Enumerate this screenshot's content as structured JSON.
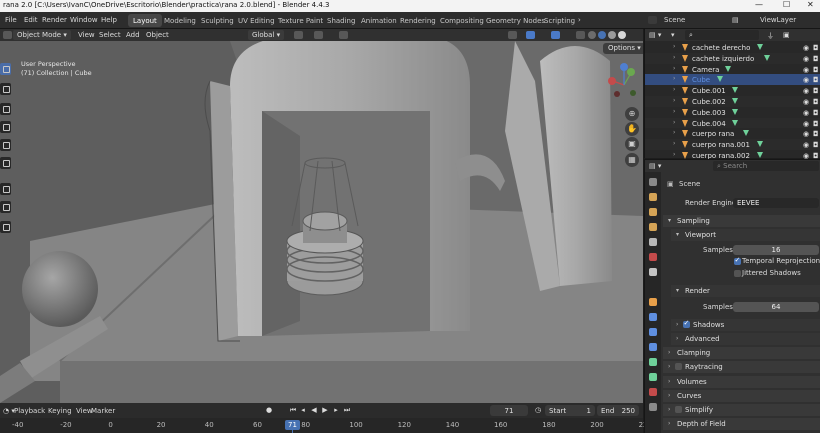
{
  "window": {
    "title": "rana 2.0 [C:\\Users\\IvanC\\OneDrive\\Escritorio\\Blender\\practica\\rana 2.0.blend] - Blender 4.4.3"
  },
  "menu": [
    "File",
    "Edit",
    "Render",
    "Window",
    "Help"
  ],
  "workspaces": {
    "active": "Layout",
    "tabs": [
      "Layout",
      "Modeling",
      "Sculpting",
      "UV Editing",
      "Texture Paint",
      "Shading",
      "Animation",
      "Rendering",
      "Compositing",
      "Geometry Nodes",
      "Scripting"
    ]
  },
  "scene": {
    "name": "Scene",
    "view_layer": "ViewLayer"
  },
  "viewport_header": {
    "mode": "Object Mode",
    "menus": [
      "View",
      "Select",
      "Add",
      "Object"
    ],
    "orientation": "Global"
  },
  "viewport": {
    "view_name": "User Perspective",
    "collection": "(71) Collection | Cube",
    "options_label": "Options",
    "gizmo_axes": {
      "x": "X",
      "y": "Y",
      "z": "Z"
    }
  },
  "timeline": {
    "menus": [
      "Playback",
      "Keying",
      "View",
      "Marker"
    ],
    "current_frame": "71",
    "start_label": "Start",
    "start": "1",
    "end_label": "End",
    "end": "250",
    "ruler": [
      "-40",
      "-20",
      "0",
      "20",
      "40",
      "60",
      "80",
      "100",
      "120",
      "140",
      "160",
      "180",
      "200",
      "220"
    ]
  },
  "outliner": {
    "items": [
      {
        "name": "cachete derecho",
        "selected": false
      },
      {
        "name": "cachete izquierdo",
        "selected": false
      },
      {
        "name": "Camera",
        "selected": false
      },
      {
        "name": "Cube",
        "selected": true
      },
      {
        "name": "Cube.001",
        "selected": false
      },
      {
        "name": "Cube.002",
        "selected": false
      },
      {
        "name": "Cube.003",
        "selected": false
      },
      {
        "name": "Cube.004",
        "selected": false
      },
      {
        "name": "cuerpo rana",
        "selected": false
      },
      {
        "name": "cuerpo rana.001",
        "selected": false
      },
      {
        "name": "cuerpo rana.002",
        "selected": false
      }
    ]
  },
  "properties": {
    "search_placeholder": "Search",
    "context": "Scene",
    "render_engine_label": "Render Engine",
    "render_engine": "EEVEE",
    "sampling": {
      "title": "Sampling",
      "viewport_title": "Viewport",
      "viewport_samples_label": "Samples",
      "viewport_samples": "16",
      "temporal_reprojection": "Temporal Reprojection",
      "temporal_reprojection_on": true,
      "jittered_shadows": "Jittered Shadows",
      "jittered_shadows_on": false,
      "render_title": "Render",
      "render_samples_label": "Samples",
      "render_samples": "64",
      "shadows": "Shadows",
      "shadows_on": true,
      "advanced": "Advanced"
    },
    "panels": [
      "Clamping",
      "Raytracing",
      "Volumes",
      "Curves",
      "Simplify",
      "Depth of Field"
    ]
  },
  "colors": {
    "accent": "#4772b3",
    "brand_orange": "#e87d0d",
    "object_orange": "#e8a04a",
    "mesh_green": "#6fd19a"
  }
}
